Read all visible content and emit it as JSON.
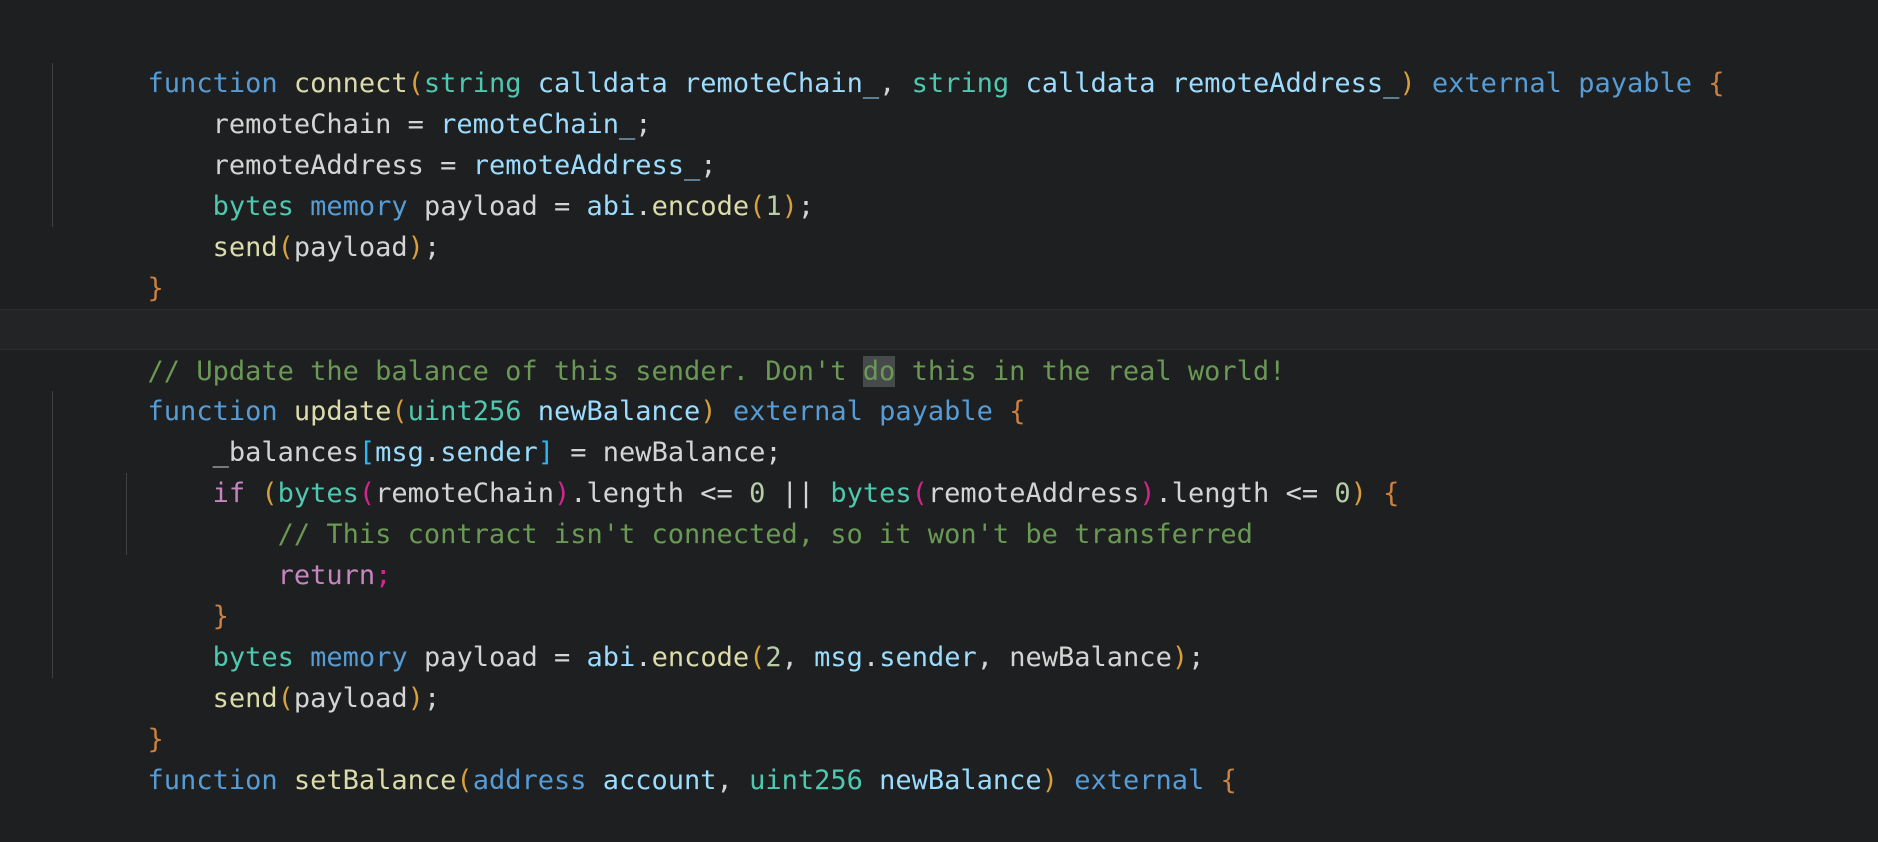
{
  "editor": {
    "language": "Solidity",
    "theme": "dark-plus",
    "background_color": "#1e1f20",
    "highlighted_line_background": "#232425",
    "word_occurrence_highlight": "#474a4b",
    "font_size_px": 27,
    "line_height_px": 41,
    "colors": {
      "keyword": "#569cd6",
      "function_name": "#dcdcaa",
      "type": "#4ec9b0",
      "variable": "#d4d4d4",
      "parameter": "#9cdcfe",
      "number": "#b5cea8",
      "comment": "#6a9955",
      "control": "#c586c0",
      "bracket_yellow": "#d7a03c",
      "bracket_magenta": "#d4258f",
      "bracket_cyan": "#29b8f6",
      "brace_orange": "#cc8141"
    }
  },
  "code": {
    "line_1": {
      "t1": "function",
      "t2": " ",
      "t3": "connect",
      "t4": "(",
      "t5": "string",
      "t6": " ",
      "t7": "calldata",
      "t8": " ",
      "t9": "remoteChain_",
      "t10": ", ",
      "t11": "string",
      "t12": " ",
      "t13": "calldata",
      "t14": " ",
      "t15": "remoteAddress_",
      "t16": ")",
      "t17": " ",
      "t18": "external",
      "t19": " ",
      "t20": "payable",
      "t21": " ",
      "t22": "{"
    },
    "line_2": {
      "t1": "remoteChain",
      "t2": " = ",
      "t3": "remoteChain_",
      "t4": ";"
    },
    "line_3": {
      "t1": "remoteAddress",
      "t2": " = ",
      "t3": "remoteAddress_",
      "t4": ";"
    },
    "line_4": {
      "t1": "bytes",
      "t2": " ",
      "t3": "memory",
      "t4": " ",
      "t5": "payload",
      "t6": " = ",
      "t7": "abi",
      "t8": ".",
      "t9": "encode",
      "t10": "(",
      "t11": "1",
      "t12": ")",
      "t13": ";"
    },
    "line_5": {
      "t1": "send",
      "t2": "(",
      "t3": "payload",
      "t4": ")",
      "t5": ";"
    },
    "line_6": {
      "t1": "}"
    },
    "line_7_comment": {
      "t1": "// Update the balance of this sender. Don't ",
      "t2": "do",
      "t3": " this in the real world!"
    },
    "line_8": {
      "t1": "function",
      "t2": " ",
      "t3": "update",
      "t4": "(",
      "t5": "uint256",
      "t6": " ",
      "t7": "newBalance",
      "t8": ")",
      "t9": " ",
      "t10": "external",
      "t11": " ",
      "t12": "payable",
      "t13": " ",
      "t14": "{"
    },
    "line_9": {
      "t1": "_balances",
      "t2": "[",
      "t3": "msg",
      "t4": ".",
      "t5": "sender",
      "t6": "]",
      "t7": " = ",
      "t8": "newBalance",
      "t9": ";"
    },
    "line_10": {
      "t1": "if",
      "t2": " ",
      "t3": "(",
      "t4": "bytes",
      "t5": "(",
      "t6": "remoteChain",
      "t7": ")",
      "t8": ".length",
      "t9": " <= ",
      "t10": "0",
      "t11": " || ",
      "t12": "bytes",
      "t13": "(",
      "t14": "remoteAddress",
      "t15": ")",
      "t16": ".length",
      "t17": " <= ",
      "t18": "0",
      "t19": ")",
      "t20": " ",
      "t21": "{"
    },
    "line_11_comment": {
      "t1": "// This contract isn't connected, so it won't be transferred"
    },
    "line_12": {
      "t1": "return",
      "t2": ";"
    },
    "line_13": {
      "t1": "}"
    },
    "line_14": {
      "t1": "bytes",
      "t2": " ",
      "t3": "memory",
      "t4": " ",
      "t5": "payload",
      "t6": " = ",
      "t7": "abi",
      "t8": ".",
      "t9": "encode",
      "t10": "(",
      "t11": "2",
      "t12": ", ",
      "t13": "msg",
      "t14": ".",
      "t15": "sender",
      "t16": ", ",
      "t17": "newBalance",
      "t18": ")",
      "t19": ";"
    },
    "line_15": {
      "t1": "send",
      "t2": "(",
      "t3": "payload",
      "t4": ")",
      "t5": ";"
    },
    "line_16": {
      "t1": "}"
    },
    "line_17": {
      "t1": "function",
      "t2": " ",
      "t3": "setBalance",
      "t4": "(",
      "t5": "address",
      "t6": " ",
      "t7": "account",
      "t8": ", ",
      "t9": "uint256",
      "t10": " ",
      "t11": "newBalance",
      "t12": ")",
      "t13": " ",
      "t14": "external",
      "t15": " ",
      "t16": "{"
    }
  }
}
